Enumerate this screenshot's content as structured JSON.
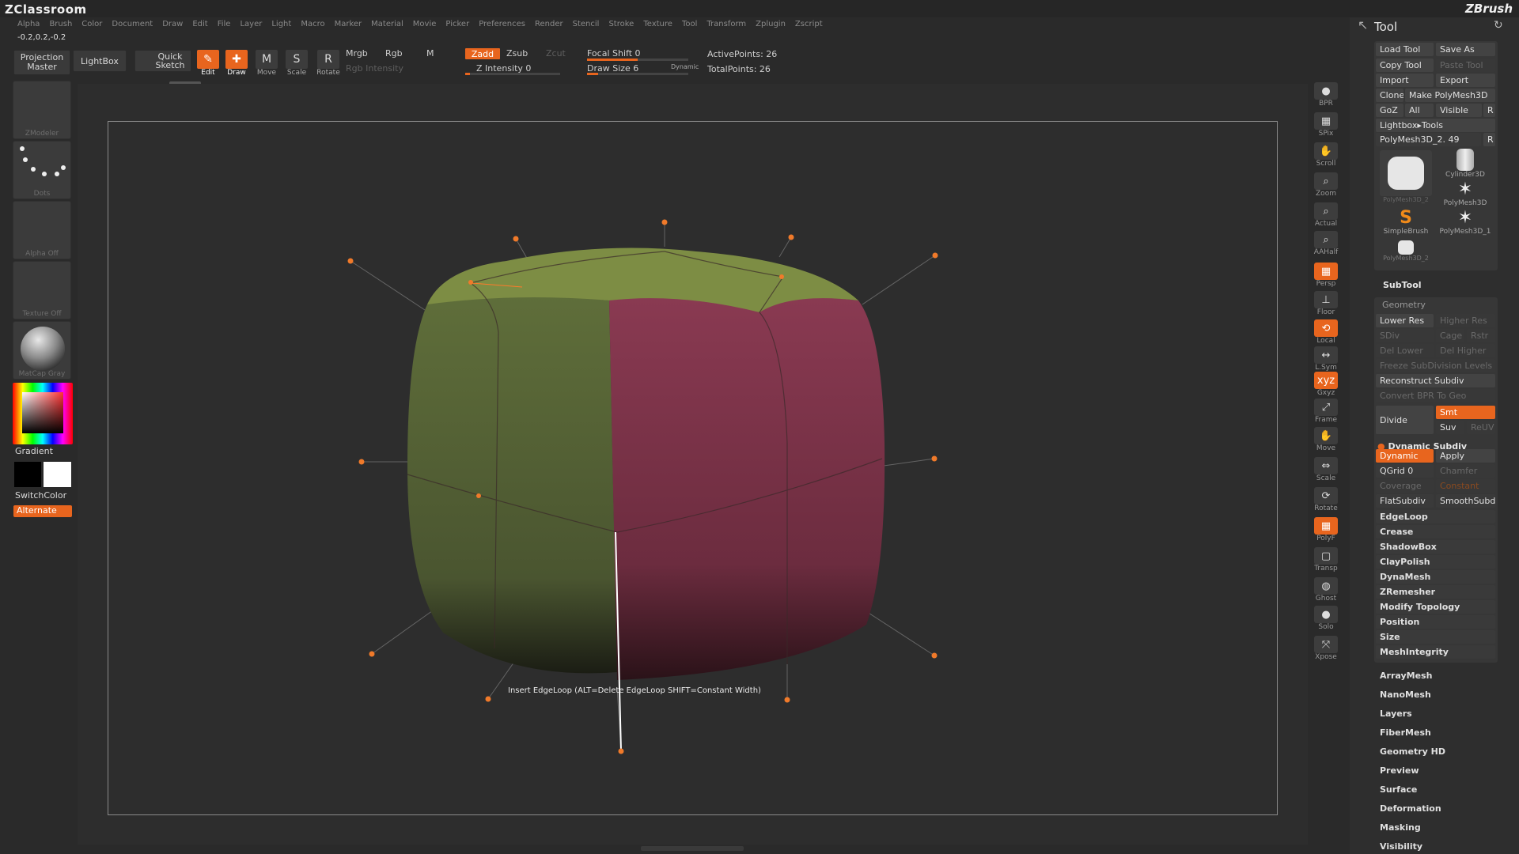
{
  "app": {
    "title": "ZClassroom",
    "brand": "ZBrush",
    "coords": "-0.2,0.2,-0.2"
  },
  "menu": [
    "Alpha",
    "Brush",
    "Color",
    "Document",
    "Draw",
    "Edit",
    "File",
    "Layer",
    "Light",
    "Macro",
    "Marker",
    "Material",
    "Movie",
    "Picker",
    "Preferences",
    "Render",
    "Stencil",
    "Stroke",
    "Texture",
    "Tool",
    "Transform",
    "Zplugin",
    "Zscript"
  ],
  "toolbar": {
    "projection_master": "Projection Master",
    "lightbox": "LightBox",
    "quick_sketch": "Quick Sketch",
    "edit": "Edit",
    "draw": "Draw",
    "move": "Move",
    "scale": "Scale",
    "rotate": "Rotate",
    "mrgb": "Mrgb",
    "rgb": "Rgb",
    "m": "M",
    "rgb_intensity": "Rgb Intensity",
    "zadd": "Zadd",
    "zsub": "Zsub",
    "zcut": "Zcut",
    "z_intensity": "Z Intensity 0",
    "focal_shift": "Focal Shift 0",
    "draw_size": "Draw Size 6",
    "dynamic": "Dynamic",
    "active_points": "ActivePoints: 26",
    "total_points": "TotalPoints: 26"
  },
  "left_shelf": {
    "brush": "ZModeler",
    "stroke": "Dots",
    "alpha": "Alpha Off",
    "texture": "Texture Off",
    "material": "MatCap Gray",
    "gradient": "Gradient",
    "switch_color": "SwitchColor",
    "alternate": "Alternate"
  },
  "viewport": {
    "tooltip": "Insert EdgeLoop (ALT=Delete EdgeLoop SHIFT=Constant Width)"
  },
  "right_shelf": [
    "BPR",
    "SPix",
    "Scroll",
    "Zoom",
    "Actual",
    "AAHalf",
    "Persp",
    "Floor",
    "Local",
    "L.Sym",
    "Gxyz",
    "Frame",
    "Move",
    "Scale",
    "Rotate",
    "PolyF",
    "Transp",
    "Ghost",
    "Solo",
    "Xpose"
  ],
  "tool_panel": {
    "title": "Tool",
    "load_tool": "Load Tool",
    "save_as": "Save As",
    "copy_tool": "Copy Tool",
    "paste_tool": "Paste Tool",
    "import": "Import",
    "export": "Export",
    "clone": "Clone",
    "make_polymesh": "Make PolyMesh3D",
    "goz": "GoZ",
    "all": "All",
    "visible": "Visible",
    "r": "R",
    "lightbox_tools": "Lightbox▸Tools",
    "current_tool": "PolyMesh3D_2. 49",
    "thumbs": [
      "PolyMesh3D_2",
      "Cylinder3D",
      "PolyMesh3D",
      "SimpleBrush",
      "PolyMesh3D_1",
      "PolyMesh3D_2"
    ],
    "subtool": "SubTool",
    "geometry": "Geometry",
    "lower_res": "Lower Res",
    "higher_res": "Higher Res",
    "sdiv": "SDiv",
    "cage": "Cage",
    "rstr": "Rstr",
    "del_lower": "Del Lower",
    "del_higher": "Del Higher",
    "freeze": "Freeze SubDivision Levels",
    "reconstruct": "Reconstruct Subdiv",
    "convert_bpr": "Convert BPR To Geo",
    "divide": "Divide",
    "smt": "Smt",
    "suv": "Suv",
    "reuv": "ReUV",
    "dynamic_subdiv": "Dynamic Subdiv",
    "dynamic": "Dynamic",
    "apply": "Apply",
    "qgrid": "QGrid 0",
    "chamfer": "Chamfer",
    "coverage": "Coverage",
    "constant": "Constant",
    "flat_subdiv": "FlatSubdiv",
    "smooth_subd": "SmoothSubd",
    "geometry_items": [
      "EdgeLoop",
      "Crease",
      "ShadowBox",
      "ClayPolish",
      "DynaMesh",
      "ZRemesher",
      "Modify Topology",
      "Position",
      "Size",
      "MeshIntegrity"
    ],
    "menus": [
      "ArrayMesh",
      "NanoMesh",
      "Layers",
      "FiberMesh",
      "Geometry HD",
      "Preview",
      "Surface",
      "Deformation",
      "Masking",
      "Visibility"
    ]
  },
  "colors": {
    "accent": "#e8651e",
    "mesh_green": "#5d6b3a",
    "mesh_red": "#7a3347",
    "mesh_top": "#7f8f45"
  }
}
